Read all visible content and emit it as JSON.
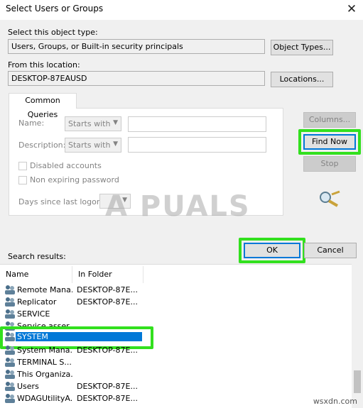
{
  "window": {
    "title": "Select Users or Groups",
    "close_glyph": "✕"
  },
  "object_type": {
    "label": "Select this object type:",
    "value": "Users, Groups, or Built-in security principals",
    "button": "Object Types..."
  },
  "location": {
    "label": "From this location:",
    "value": "DESKTOP-87EAUSD",
    "button": "Locations..."
  },
  "queries": {
    "tab": "Common Queries",
    "name_label": "Name:",
    "description_label": "Description:",
    "starts_with": "Starts with",
    "disabled_accounts": "Disabled accounts",
    "non_expiring": "Non expiring password",
    "days_label": "Days since last logon:"
  },
  "buttons": {
    "columns": "Columns...",
    "find_now": "Find Now",
    "stop": "Stop",
    "ok": "OK",
    "cancel": "Cancel"
  },
  "results": {
    "label": "Search results:",
    "columns": [
      "Name",
      "In Folder"
    ],
    "rows": [
      {
        "name": "Remote Mana...",
        "folder": "DESKTOP-87E..."
      },
      {
        "name": "Replicator",
        "folder": "DESKTOP-87E..."
      },
      {
        "name": "SERVICE",
        "folder": ""
      },
      {
        "name": "Service asser...",
        "folder": ""
      },
      {
        "name": "SYSTEM",
        "folder": ""
      },
      {
        "name": "System Mana...",
        "folder": "DESKTOP-87E..."
      },
      {
        "name": "TERMINAL S...",
        "folder": ""
      },
      {
        "name": "This Organiza...",
        "folder": ""
      },
      {
        "name": "Users",
        "folder": "DESKTOP-87E..."
      },
      {
        "name": "WDAGUtilityA...",
        "folder": "DESKTOP-87E..."
      }
    ]
  },
  "watermark": "A PUALS",
  "footer_text": "wsxdn.com",
  "colors": {
    "highlight": "#32e01e",
    "selection": "#0078d7"
  }
}
